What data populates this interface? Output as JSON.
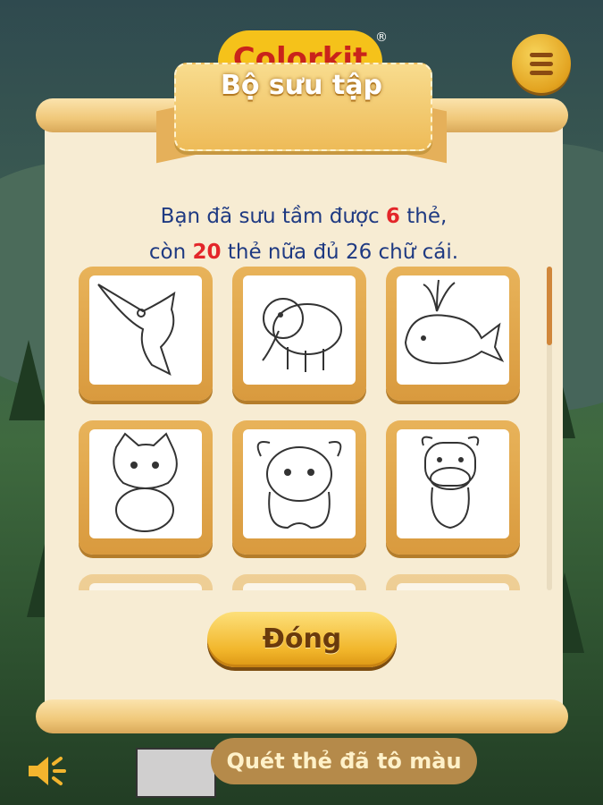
{
  "app": {
    "logo_text": "Colorkit",
    "registered_mark": "®"
  },
  "header": {
    "menu_icon": "list-menu-icon"
  },
  "dialog": {
    "title": "Bộ sưu tập",
    "info_line1_prefix": "Bạn đã sưu tầm được",
    "collected_count": "6",
    "info_line1_suffix": "thẻ,",
    "info_line2_prefix": "còn",
    "remaining_count": "20",
    "info_line2_suffix": "thẻ nữa đủ 26 chữ cái.",
    "cards": [
      {
        "name": "swordfish",
        "icon": "swordfish-drawing"
      },
      {
        "name": "elephant",
        "icon": "elephant-drawing"
      },
      {
        "name": "whale",
        "icon": "whale-drawing"
      },
      {
        "name": "cat",
        "icon": "cat-drawing"
      },
      {
        "name": "yak",
        "icon": "yak-drawing"
      },
      {
        "name": "cow",
        "icon": "cow-drawing"
      }
    ],
    "close_label": "Đóng"
  },
  "footer": {
    "scan_button_label": "Quét thẻ đã tô màu",
    "speaker_icon": "speaker-icon"
  },
  "colors": {
    "accent_gold": "#f1b52a",
    "info_text": "#1f3a82",
    "count_red": "#e3262a"
  }
}
